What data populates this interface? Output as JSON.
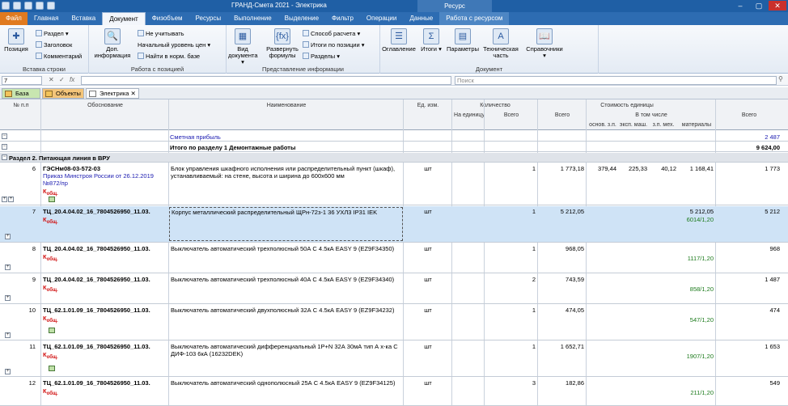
{
  "app": {
    "title": "ГРАНД-Смета 2021 - Электрика",
    "context_tab_group": "Ресурс",
    "win_min": "–",
    "win_max": "▢",
    "win_close": "✕"
  },
  "ribbon_tabs": [
    {
      "label": "Файл"
    },
    {
      "label": "Главная"
    },
    {
      "label": "Вставка"
    },
    {
      "label": "Документ"
    },
    {
      "label": "Физобъем"
    },
    {
      "label": "Ресурсы"
    },
    {
      "label": "Выполнение"
    },
    {
      "label": "Выделение"
    },
    {
      "label": "Фильтр"
    },
    {
      "label": "Операции"
    },
    {
      "label": "Данные"
    },
    {
      "label": "Работа с ресурсом"
    }
  ],
  "ribbon": {
    "groups": {
      "insert_row": "Вставка строки",
      "positions": "Работа с позицией",
      "view": "Представление информации",
      "document": "Документ"
    },
    "position": "Позиция",
    "section": "Раздел",
    "header": "Заголовок",
    "comment": "Комментарий",
    "extra_info": "Доп. информация",
    "not_count": "Не учитывать",
    "initial_price": "Начальный уровень цен",
    "find_base": "Найти в норм. базе",
    "view_doc": "Вид документа",
    "formulas": "Развернуть формулы",
    "calc_method": "Способ расчета",
    "totals_by_pos": "Итоги по позиции",
    "sections": "Разделы",
    "contents": "Оглавление",
    "totals": "Итоги",
    "params": "Параметры",
    "tech_part": "Техническая часть",
    "refs": "Справочники"
  },
  "formula_bar": {
    "cell": "7",
    "value": "",
    "search_placeholder": "Поиск",
    "fx": "fx"
  },
  "doc_tabs": [
    {
      "label": "База"
    },
    {
      "label": "Объекты"
    },
    {
      "label": "Электрика"
    }
  ],
  "columns": {
    "num": "№ п.п",
    "basis": "Обоснование",
    "name": "Наименование",
    "unit": "Ед. изм.",
    "qty": "Количество",
    "per_unit": "На единицу",
    "total": "Всего",
    "unit_cost": "Стоимость единицы",
    "cost_total": "Всего",
    "incl": "В том числе",
    "osn": "основ. з.п.",
    "eksp": "эксп. маш.",
    "zpmeh": "з.п. мех.",
    "mat": "материалы",
    "grand": "Всего"
  },
  "summary_rows": [
    {
      "name": "Сметная прибыль",
      "total": "2 487"
    },
    {
      "name": "Итого по разделу 1 Демонтажные работы",
      "total": "9 624,00"
    }
  ],
  "section_title": "Раздел 2. Питающая линия в ВРУ",
  "rows": [
    {
      "num": "6",
      "code": "ГЭСНм08-03-572-03",
      "sub": "Приказ Минстроя России от 26.12.2019 №872/пр",
      "name": "Блок управления шкафного исполнения или распределительный пункт (шкаф), устанавливаемый: на стене, высота и ширина до 600х600 мм",
      "unit": "шт",
      "qty": "1",
      "cost": "1 773,18",
      "osn": "379,44",
      "eksp": "225,33",
      "zpmeh": "40,12",
      "mat": "1 168,41",
      "ratio": "",
      "grand": "1 773"
    },
    {
      "num": "7",
      "code": "ТЦ_20.4.04.02_16_7804526950_11.03.",
      "sub": "",
      "name": "Корпус металлический распределительный ЩРн-72з-1 36 УХЛ3 IP31 IEK",
      "unit": "шт",
      "qty": "1",
      "cost": "5 212,05",
      "osn": "",
      "eksp": "",
      "zpmeh": "",
      "mat": "5 212,05",
      "ratio": "6014/1,20",
      "grand": "5 212"
    },
    {
      "num": "8",
      "code": "ТЦ_20.4.04.02_16_7804526950_11.03.",
      "sub": "",
      "name": "Выключатель автоматический трехполюсный 50А С 4.5кА EASY 9 (EZ9F34350)",
      "unit": "шт",
      "qty": "1",
      "cost": "968,05",
      "osn": "",
      "eksp": "",
      "zpmeh": "",
      "mat": "",
      "ratio": "1117/1,20",
      "grand": "968"
    },
    {
      "num": "9",
      "code": "ТЦ_20.4.04.02_16_7804526950_11.03.",
      "sub": "",
      "name": "Выключатель автоматический трехполюсный 40А С 4.5кА EASY 9 (EZ9F34340)",
      "unit": "шт",
      "qty": "2",
      "cost": "743,59",
      "osn": "",
      "eksp": "",
      "zpmeh": "",
      "mat": "",
      "ratio": "858/1,20",
      "grand": "1 487"
    },
    {
      "num": "10",
      "code": "ТЦ_62.1.01.09_16_7804526950_11.03.",
      "sub": "",
      "name": "Выключатель автоматический двухполюсный 32А С 4.5кА EASY 9 (EZ9F34232)",
      "unit": "шт",
      "qty": "1",
      "cost": "474,05",
      "osn": "",
      "eksp": "",
      "zpmeh": "",
      "mat": "",
      "ratio": "547/1,20",
      "grand": "474"
    },
    {
      "num": "11",
      "code": "ТЦ_62.1.01.09_16_7804526950_11.03.",
      "sub": "",
      "name": "Выключатель автоматический дифференциальный 1P+N 32А 30мА тип А х-ка С ДИФ-103 6кА (16232DEK)",
      "unit": "шт",
      "qty": "1",
      "cost": "1 652,71",
      "osn": "",
      "eksp": "",
      "zpmeh": "",
      "mat": "",
      "ratio": "1907/1,20",
      "grand": "1 653"
    },
    {
      "num": "12",
      "code": "ТЦ_62.1.01.09_16_7804526950_11.03.",
      "sub": "",
      "name": "Выключатель автоматический однополюсный 25А С 4.5кА EASY 9 (EZ9F34125)",
      "unit": "шт",
      "qty": "3",
      "cost": "182,86",
      "osn": "",
      "eksp": "",
      "zpmeh": "",
      "mat": "",
      "ratio": "211/1,20",
      "grand": "549"
    }
  ],
  "koef_label": "К",
  "koef_sub": "общ."
}
